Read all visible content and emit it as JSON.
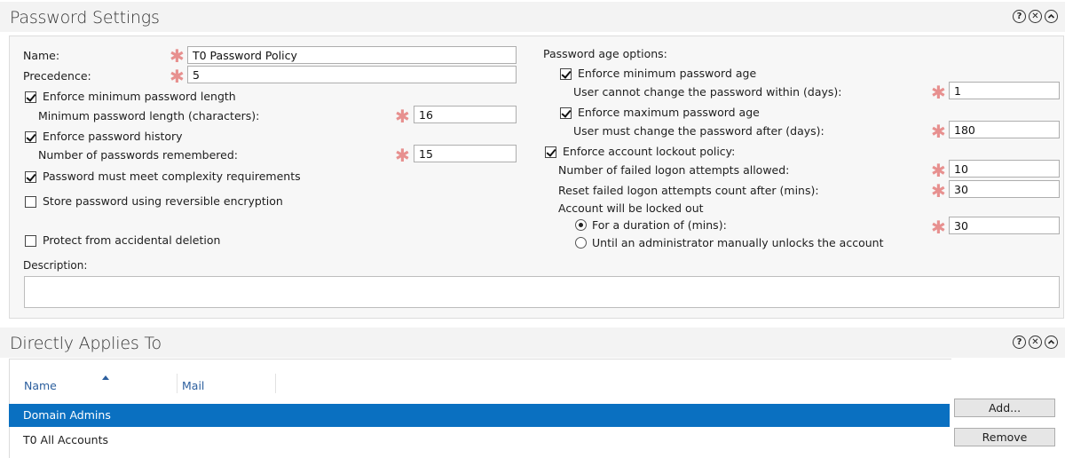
{
  "password_settings": {
    "title": "Password Settings",
    "name_label": "Name:",
    "name_value": "T0 Password Policy",
    "precedence_label": "Precedence:",
    "precedence_value": "5",
    "enforce_min_length_label": "Enforce minimum password length",
    "enforce_min_length_checked": true,
    "min_length_label": "Minimum password length (characters):",
    "min_length_value": "16",
    "enforce_history_label": "Enforce password history",
    "enforce_history_checked": true,
    "passwords_remembered_label": "Number of passwords remembered:",
    "passwords_remembered_value": "15",
    "complexity_label": "Password must meet complexity requirements",
    "complexity_checked": true,
    "reversible_label": "Store password using reversible encryption",
    "reversible_checked": false,
    "protect_label": "Protect from accidental deletion",
    "protect_checked": false,
    "description_label": "Description:",
    "description_value": "",
    "age_options_label": "Password age options:",
    "enforce_min_age_label": "Enforce minimum password age",
    "enforce_min_age_checked": true,
    "min_age_label": "User cannot change the password within (days):",
    "min_age_value": "1",
    "enforce_max_age_label": "Enforce maximum password age",
    "enforce_max_age_checked": true,
    "max_age_label": "User must change the password after (days):",
    "max_age_value": "180",
    "lockout_label": "Enforce account lockout policy:",
    "lockout_checked": true,
    "failed_attempts_label": "Number of failed logon attempts allowed:",
    "failed_attempts_value": "10",
    "reset_count_label": "Reset failed logon attempts count after (mins):",
    "reset_count_value": "30",
    "locked_out_label": "Account will be locked out",
    "duration_label": "For a duration of (mins):",
    "duration_value": "30",
    "duration_selected": true,
    "admin_unlock_label": "Until an administrator manually unlocks the account",
    "admin_unlock_selected": false
  },
  "applies_to": {
    "title": "Directly Applies To",
    "columns": [
      "Name",
      "Mail"
    ],
    "rows": [
      {
        "name": "Domain Admins",
        "mail": "",
        "selected": true
      },
      {
        "name": "T0 All Accounts",
        "mail": "",
        "selected": false
      }
    ],
    "add_label": "Add...",
    "remove_label": "Remove"
  },
  "header_icons": {
    "help": "?",
    "close": "✕",
    "collapse": "^"
  },
  "colors": {
    "required_star": "#e7908f",
    "selected_row": "#0a70c1",
    "column_header": "#2c5f9e"
  }
}
